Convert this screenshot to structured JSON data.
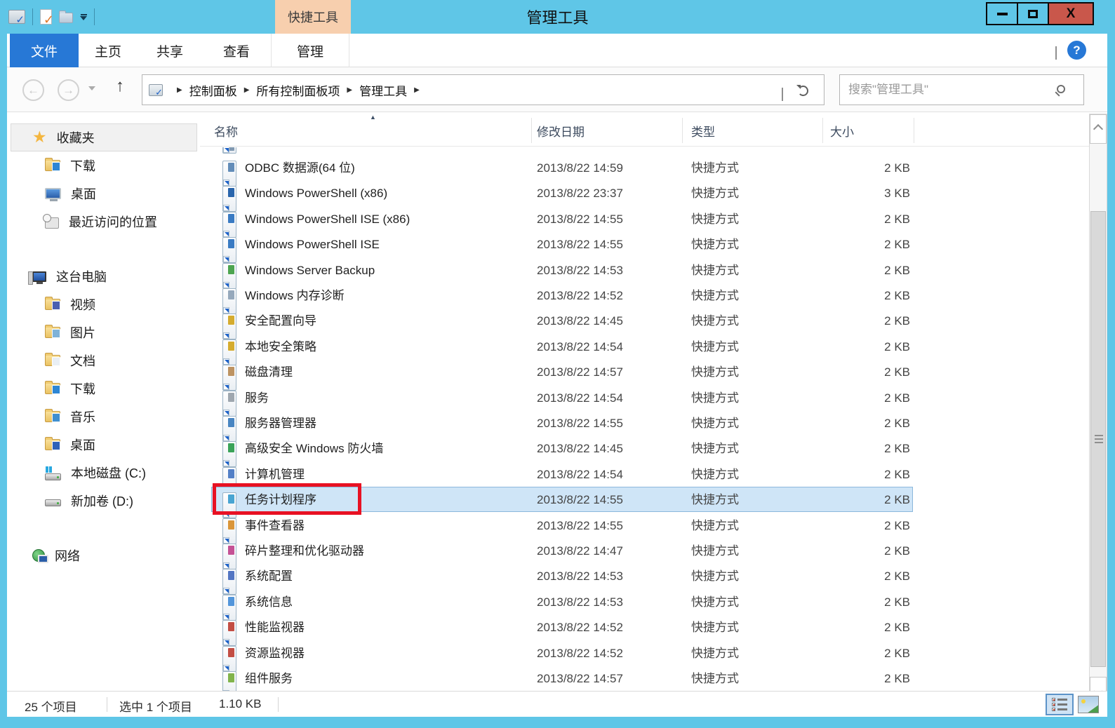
{
  "window": {
    "title": "管理工具",
    "contextual_tab": "快捷工具",
    "qat_icons": [
      "admin-tools-app-icon",
      "properties-icon",
      "new-folder-icon",
      "qat-dropdown"
    ],
    "controls": {
      "minimize": "minimize",
      "maximize": "maximize",
      "close": "X"
    }
  },
  "ribbon": {
    "file_tab": "文件",
    "tabs": [
      "主页",
      "共享",
      "查看",
      "管理"
    ],
    "active_contextual_tab": "管理",
    "help_label": "?"
  },
  "address_bar": {
    "breadcrumb": [
      "控制面板",
      "所有控制面板项",
      "管理工具"
    ],
    "search_placeholder": "搜索\"管理工具\""
  },
  "sidebar": {
    "sections": [
      {
        "label": "收藏夹",
        "icon": "star-icon",
        "highlighted": true,
        "children": [
          {
            "label": "下载",
            "icon": "download-folder-icon"
          },
          {
            "label": "桌面",
            "icon": "desktop-monitor-icon"
          },
          {
            "label": "最近访问的位置",
            "icon": "recent-places-icon"
          }
        ]
      },
      {
        "label": "这台电脑",
        "icon": "computer-icon",
        "highlighted": false,
        "children": [
          {
            "label": "视频",
            "icon": "videos-folder-icon"
          },
          {
            "label": "图片",
            "icon": "pictures-folder-icon"
          },
          {
            "label": "文档",
            "icon": "documents-folder-icon"
          },
          {
            "label": "下载",
            "icon": "download-folder-icon"
          },
          {
            "label": "音乐",
            "icon": "music-folder-icon"
          },
          {
            "label": "桌面",
            "icon": "desktop-folder-icon"
          },
          {
            "label": "本地磁盘 (C:)",
            "icon": "disk-c-icon"
          },
          {
            "label": "新加卷 (D:)",
            "icon": "disk-d-icon"
          }
        ]
      },
      {
        "label": "网络",
        "icon": "network-icon",
        "highlighted": false,
        "children": []
      }
    ]
  },
  "file_list": {
    "columns": [
      {
        "label": "名称",
        "sort": "asc"
      },
      {
        "label": "修改日期"
      },
      {
        "label": "类型"
      },
      {
        "label": "大小"
      }
    ],
    "rows": [
      {
        "name": "ODBC 数据源(64 位)",
        "date": "2013/8/22 14:59",
        "type": "快捷方式",
        "size": "2 KB",
        "icon": "odbc-shortcut-icon",
        "accent": "#5b87b5"
      },
      {
        "name": "Windows PowerShell (x86)",
        "date": "2013/8/22 23:37",
        "type": "快捷方式",
        "size": "3 KB",
        "icon": "powershell-shortcut-icon",
        "accent": "#1d5da8"
      },
      {
        "name": "Windows PowerShell ISE (x86)",
        "date": "2013/8/22 14:55",
        "type": "快捷方式",
        "size": "2 KB",
        "icon": "powershell-ise-shortcut-icon",
        "accent": "#2f74c0"
      },
      {
        "name": "Windows PowerShell ISE",
        "date": "2013/8/22 14:55",
        "type": "快捷方式",
        "size": "2 KB",
        "icon": "powershell-ise-shortcut-icon",
        "accent": "#2f74c0"
      },
      {
        "name": "Windows Server Backup",
        "date": "2013/8/22 14:53",
        "type": "快捷方式",
        "size": "2 KB",
        "icon": "server-backup-shortcut-icon",
        "accent": "#43a047"
      },
      {
        "name": "Windows 内存诊断",
        "date": "2013/8/22 14:52",
        "type": "快捷方式",
        "size": "2 KB",
        "icon": "memory-diagnostic-shortcut-icon",
        "accent": "#90a4b8"
      },
      {
        "name": "安全配置向导",
        "date": "2013/8/22 14:45",
        "type": "快捷方式",
        "size": "2 KB",
        "icon": "security-wizard-shortcut-icon",
        "accent": "#d3a824"
      },
      {
        "name": "本地安全策略",
        "date": "2013/8/22 14:54",
        "type": "快捷方式",
        "size": "2 KB",
        "icon": "local-security-policy-shortcut-icon",
        "accent": "#d3a824"
      },
      {
        "name": "磁盘清理",
        "date": "2013/8/22 14:57",
        "type": "快捷方式",
        "size": "2 KB",
        "icon": "disk-cleanup-shortcut-icon",
        "accent": "#b98d5a"
      },
      {
        "name": "服务",
        "date": "2013/8/22 14:54",
        "type": "快捷方式",
        "size": "2 KB",
        "icon": "services-shortcut-icon",
        "accent": "#9aa2ab"
      },
      {
        "name": "服务器管理器",
        "date": "2013/8/22 14:55",
        "type": "快捷方式",
        "size": "2 KB",
        "icon": "server-manager-shortcut-icon",
        "accent": "#3f7fbf"
      },
      {
        "name": "高级安全 Windows 防火墙",
        "date": "2013/8/22 14:45",
        "type": "快捷方式",
        "size": "2 KB",
        "icon": "firewall-shortcut-icon",
        "accent": "#2f9e50"
      },
      {
        "name": "计算机管理",
        "date": "2013/8/22 14:54",
        "type": "快捷方式",
        "size": "2 KB",
        "icon": "computer-management-shortcut-icon",
        "accent": "#4a79c4"
      },
      {
        "name": "任务计划程序",
        "date": "2013/8/22 14:55",
        "type": "快捷方式",
        "size": "2 KB",
        "icon": "task-scheduler-shortcut-icon",
        "accent": "#3fa0d0",
        "selected": true,
        "red_highlight_box": true
      },
      {
        "name": "事件查看器",
        "date": "2013/8/22 14:55",
        "type": "快捷方式",
        "size": "2 KB",
        "icon": "event-viewer-shortcut-icon",
        "accent": "#d8902f"
      },
      {
        "name": "碎片整理和优化驱动器",
        "date": "2013/8/22 14:47",
        "type": "快捷方式",
        "size": "2 KB",
        "icon": "defrag-shortcut-icon",
        "accent": "#c2498f"
      },
      {
        "name": "系统配置",
        "date": "2013/8/22 14:53",
        "type": "快捷方式",
        "size": "2 KB",
        "icon": "system-configuration-shortcut-icon",
        "accent": "#4a6fc0"
      },
      {
        "name": "系统信息",
        "date": "2013/8/22 14:53",
        "type": "快捷方式",
        "size": "2 KB",
        "icon": "system-information-shortcut-icon",
        "accent": "#4a90d9"
      },
      {
        "name": "性能监视器",
        "date": "2013/8/22 14:52",
        "type": "快捷方式",
        "size": "2 KB",
        "icon": "performance-monitor-shortcut-icon",
        "accent": "#c0453a"
      },
      {
        "name": "资源监视器",
        "date": "2013/8/22 14:52",
        "type": "快捷方式",
        "size": "2 KB",
        "icon": "resource-monitor-shortcut-icon",
        "accent": "#c0453a"
      },
      {
        "name": "组件服务",
        "date": "2013/8/22 14:57",
        "type": "快捷方式",
        "size": "2 KB",
        "icon": "component-services-shortcut-icon",
        "accent": "#7ab042"
      }
    ]
  },
  "status_bar": {
    "item_count": "25 个项目",
    "selection_count": "选中 1 个项目",
    "selection_size": "1.10 KB"
  },
  "colors": {
    "frame": "#5fc6e7",
    "file_tab_blue": "#2778d6",
    "contextual_tab_peach": "#f7cfae",
    "selection_bg": "#cfe5f7",
    "selection_border": "#8bb8dc",
    "red_highlight": "#e81123",
    "close_button": "#c9574b"
  }
}
